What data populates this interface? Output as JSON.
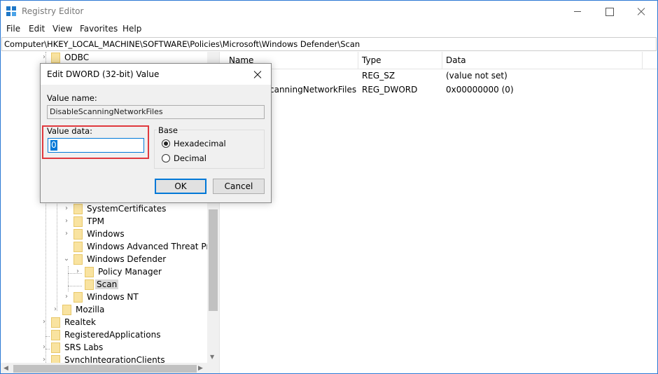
{
  "window": {
    "title": "Registry Editor"
  },
  "menu": [
    "File",
    "Edit",
    "View",
    "Favorites",
    "Help"
  ],
  "address": "Computer\\HKEY_LOCAL_MACHINE\\SOFTWARE\\Policies\\Microsoft\\Windows Defender\\Scan",
  "tree": {
    "items": [
      {
        "label": "ODBC"
      },
      {
        "label": "SystemCertificates"
      },
      {
        "label": "TPM"
      },
      {
        "label": "Windows"
      },
      {
        "label": "Windows Advanced Threat Prote"
      },
      {
        "label": "Windows Defender"
      },
      {
        "label": "Policy Manager"
      },
      {
        "label": "Scan"
      },
      {
        "label": "Windows NT"
      },
      {
        "label": "Mozilla"
      },
      {
        "label": "Realtek"
      },
      {
        "label": "RegisteredApplications"
      },
      {
        "label": "SRS Labs"
      },
      {
        "label": "SynchIntegrationClients"
      }
    ]
  },
  "list": {
    "columns": [
      "Name",
      "Type",
      "Data"
    ],
    "rows": [
      {
        "name": "",
        "type": "REG_SZ",
        "data": "(value not set)"
      },
      {
        "name": "canningNetworkFiles",
        "type": "REG_DWORD",
        "data": "0x00000000 (0)"
      }
    ]
  },
  "dialog": {
    "title": "Edit DWORD (32-bit) Value",
    "value_name_label": "Value name:",
    "value_name": "DisableScanningNetworkFiles",
    "value_data_label": "Value data:",
    "value_data": "0",
    "base_label": "Base",
    "base_options": [
      "Hexadecimal",
      "Decimal"
    ],
    "ok_label": "OK",
    "cancel_label": "Cancel"
  },
  "colors": {
    "accent": "#0078d7",
    "highlight": "#e0393e",
    "folder": "#f9e3a0"
  }
}
